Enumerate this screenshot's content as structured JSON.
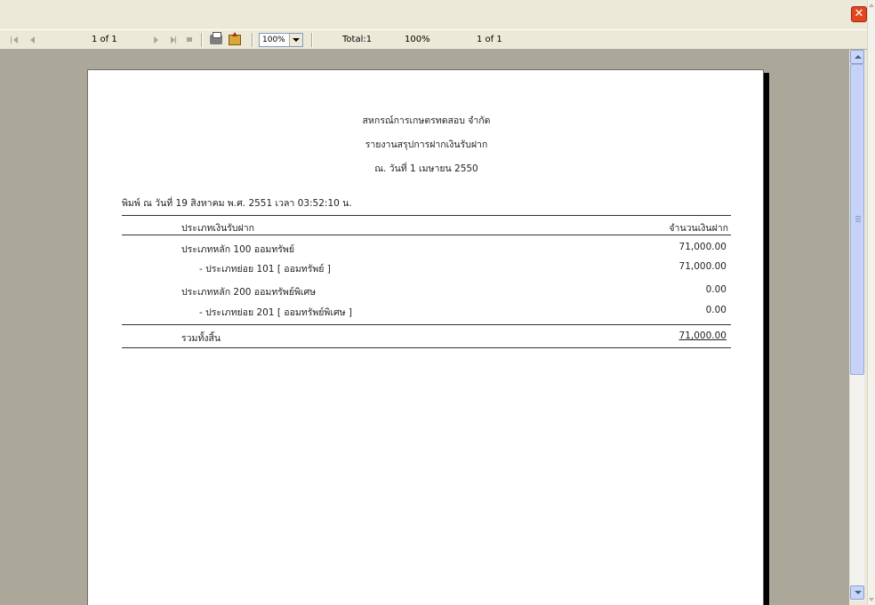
{
  "toolbar": {
    "page_indicator": "1 of 1",
    "zoom_value": "100%",
    "total_label": "Total:1",
    "zoom_status": "100%",
    "page_status": "1 of 1"
  },
  "report": {
    "org_name": "สหกรณ์การเกษตรทดสอบ จำกัด",
    "report_title": "รายงานสรุปการฝากเงินรับฝาก",
    "as_of_date": "ณ. วันที่ 1 เมษายน 2550",
    "printed_at": "พิมพ์ ณ วันที่ 19 สิงหาคม พ.ศ. 2551 เวลา 03:52:10 น.",
    "col_type": "ประเภทเงินรับฝาก",
    "col_amount": "จำนวนเงินฝาก",
    "rows": [
      {
        "label": "ประเภทหลัก 100 ออมทรัพย์",
        "amount": "71,000.00"
      },
      {
        "label": "- ประเภทย่อย 101 [ ออมทรัพย์ ]",
        "amount": "71,000.00"
      },
      {
        "label": "ประเภทหลัก 200 ออมทรัพย์พิเศษ",
        "amount": "0.00"
      },
      {
        "label": "- ประเภทย่อย 201 [ ออมทรัพย์พิเศษ ]",
        "amount": "0.00"
      }
    ],
    "total_label": "รวมทั้งสิ้น",
    "total_amount": "71,000.00"
  },
  "icons": {
    "close": "close-icon",
    "first_page": "first-page-icon",
    "prev_page": "prev-page-icon",
    "next_page": "next-page-icon",
    "last_page": "last-page-icon",
    "stop": "stop-icon",
    "print": "print-icon",
    "export": "export-icon"
  },
  "colors": {
    "close_button": "#e2461f",
    "viewport_bg": "#aca899",
    "scroll_thumb": "#c6d3f7"
  }
}
